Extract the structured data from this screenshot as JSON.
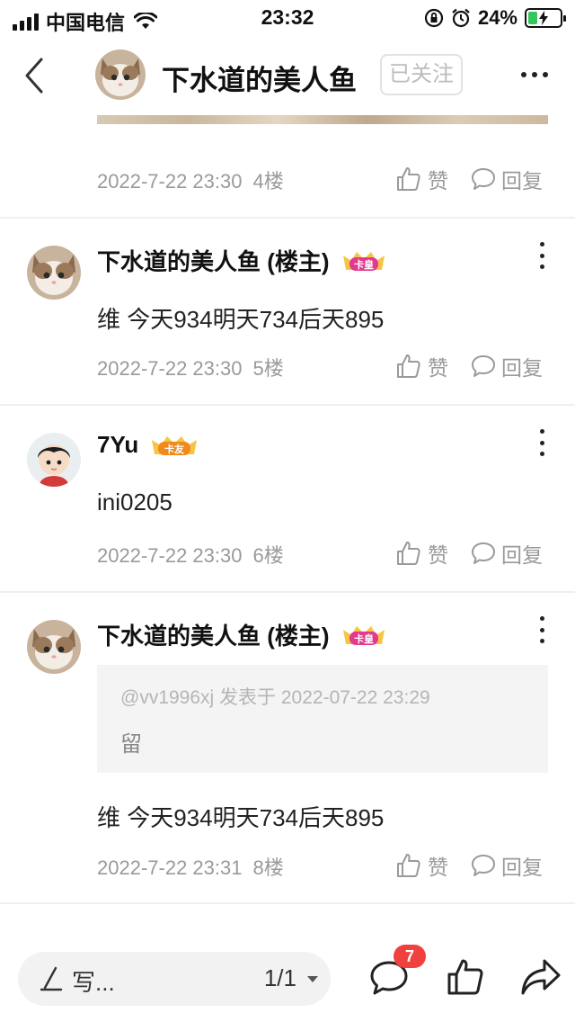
{
  "status_bar": {
    "carrier": "中国电信",
    "time": "23:32",
    "battery_pct": "24%",
    "battery_level": 0.24
  },
  "nav": {
    "title": "下水道的美人鱼",
    "follow_label": "已关注"
  },
  "posts": [
    {
      "date": "2022-7-22 23:30",
      "floor": "4楼",
      "like_label": "赞",
      "reply_label": "回复"
    },
    {
      "user": "下水道的美人鱼 (楼主)",
      "badge": "卡皇",
      "text": "维 今天934明天734后天895",
      "date": "2022-7-22 23:30",
      "floor": "5楼",
      "like_label": "赞",
      "reply_label": "回复"
    },
    {
      "user": "7Yu",
      "badge": "卡友",
      "text": "ini0205",
      "date": "2022-7-22 23:30",
      "floor": "6楼",
      "like_label": "赞",
      "reply_label": "回复"
    },
    {
      "user": "下水道的美人鱼 (楼主)",
      "badge": "卡皇",
      "quote_meta": "@vv1996xj 发表于 2022-07-22 23:29",
      "quote_text": "留",
      "text": "维 今天934明天734后天895",
      "date": "2022-7-22 23:31",
      "floor": "8楼",
      "like_label": "赞",
      "reply_label": "回复"
    }
  ],
  "bottom_bar": {
    "compose_label": "写...",
    "page_indicator": "1/1",
    "comment_count": "7"
  },
  "colors": {
    "accent_red": "#f0413f",
    "meta_gray": "#9a9a9a",
    "battery_green": "#34c759",
    "badge_pink": "#e23a8f",
    "badge_orange": "#f08a1c"
  }
}
